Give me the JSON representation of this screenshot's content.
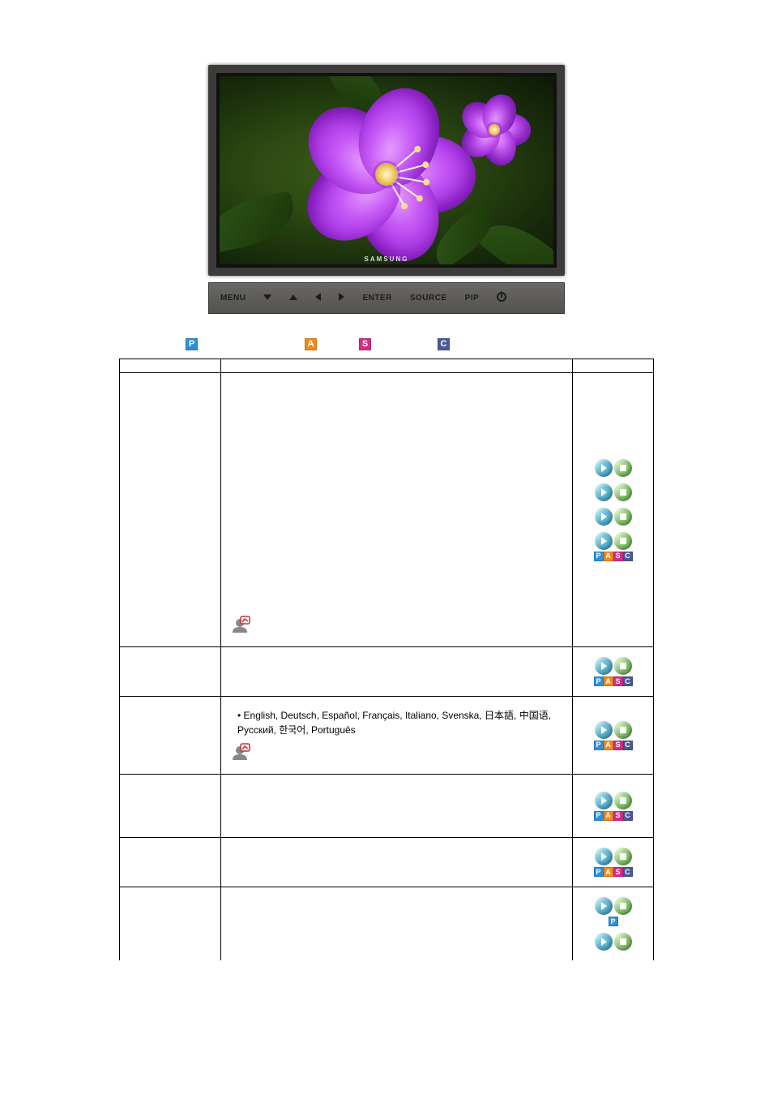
{
  "legend": {
    "P": "P",
    "A": "A",
    "S": "S",
    "C": "C"
  },
  "tv": {
    "brand": "SAMSUNG",
    "controls": {
      "menu": "MENU",
      "enter": "ENTER",
      "source": "SOURCE",
      "pip": "PIP"
    }
  },
  "table": {
    "rows": {
      "r1_col1": "",
      "r1_col2": "",
      "r2_col1": "",
      "r2_col2": "",
      "r3_col1": "",
      "r3_col2": "",
      "r4_col1": "",
      "r4_langs": "• English, Deutsch, Español, Français, Italiano, Svenska, 日本語, 中国语, Русский, 한국어,  Português",
      "r5_col1": "",
      "r5_col2": "",
      "r6_col1": "",
      "r6_col2": "",
      "r7_col1": "",
      "r7_col2": ""
    }
  }
}
